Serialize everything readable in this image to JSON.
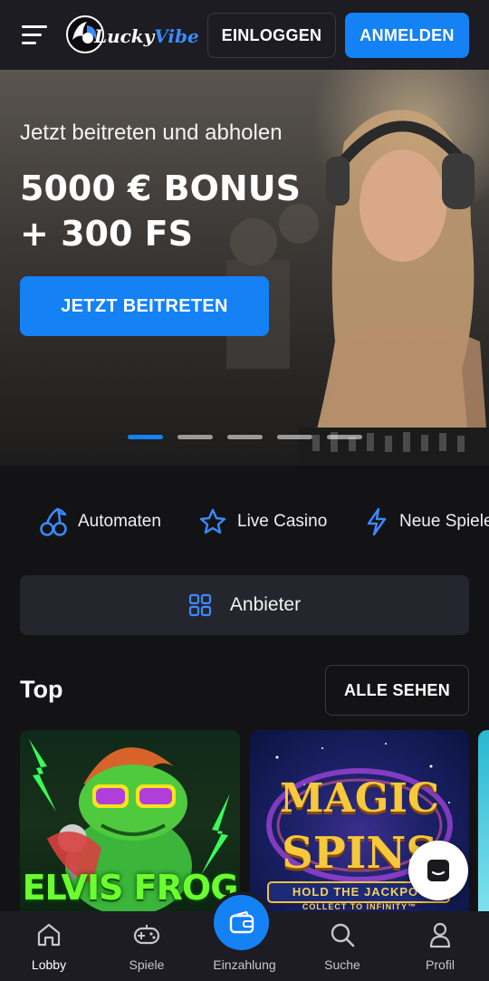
{
  "header": {
    "menu_icon": "hamburger-menu-icon",
    "logo_text_1": "Lucky",
    "logo_text_2": "Vibe",
    "login_label": "EINLOGGEN",
    "register_label": "ANMELDEN"
  },
  "hero": {
    "subtitle": "Jetzt beitreten und abholen",
    "title_line1": "5000 € BONUS",
    "title_line2": "+ 300 FS",
    "cta_label": "JETZT BEITRETEN",
    "slides_count": 5,
    "active_slide": 1
  },
  "categories": [
    {
      "label": "Automaten",
      "icon": "cherries-icon"
    },
    {
      "label": "Live Casino",
      "icon": "star-icon"
    },
    {
      "label": "Neue Spiele",
      "icon": "lightning-icon"
    }
  ],
  "provider_label": "Anbieter",
  "top_section": {
    "title": "Top",
    "see_all_label": "ALLE SEHEN",
    "games": [
      {
        "name": "ELVIS FROG"
      },
      {
        "name_1": "MAGIC",
        "name_2": "SPINS",
        "tagline": "HOLD THE JACKPOT",
        "subline": "COLLECT TO INFINITY™"
      }
    ]
  },
  "bottom_nav": [
    {
      "label": "Lobby",
      "icon": "home-icon",
      "active": true
    },
    {
      "label": "Spiele",
      "icon": "gamepad-icon",
      "active": false
    },
    {
      "label": "Einzahlung",
      "icon": "wallet-icon",
      "active": false
    },
    {
      "label": "Suche",
      "icon": "search-icon",
      "active": false
    },
    {
      "label": "Profil",
      "icon": "user-icon",
      "active": false
    }
  ],
  "colors": {
    "accent": "#1481f5",
    "background": "#131316",
    "header": "#1c1c22",
    "surface": "#25252d"
  }
}
